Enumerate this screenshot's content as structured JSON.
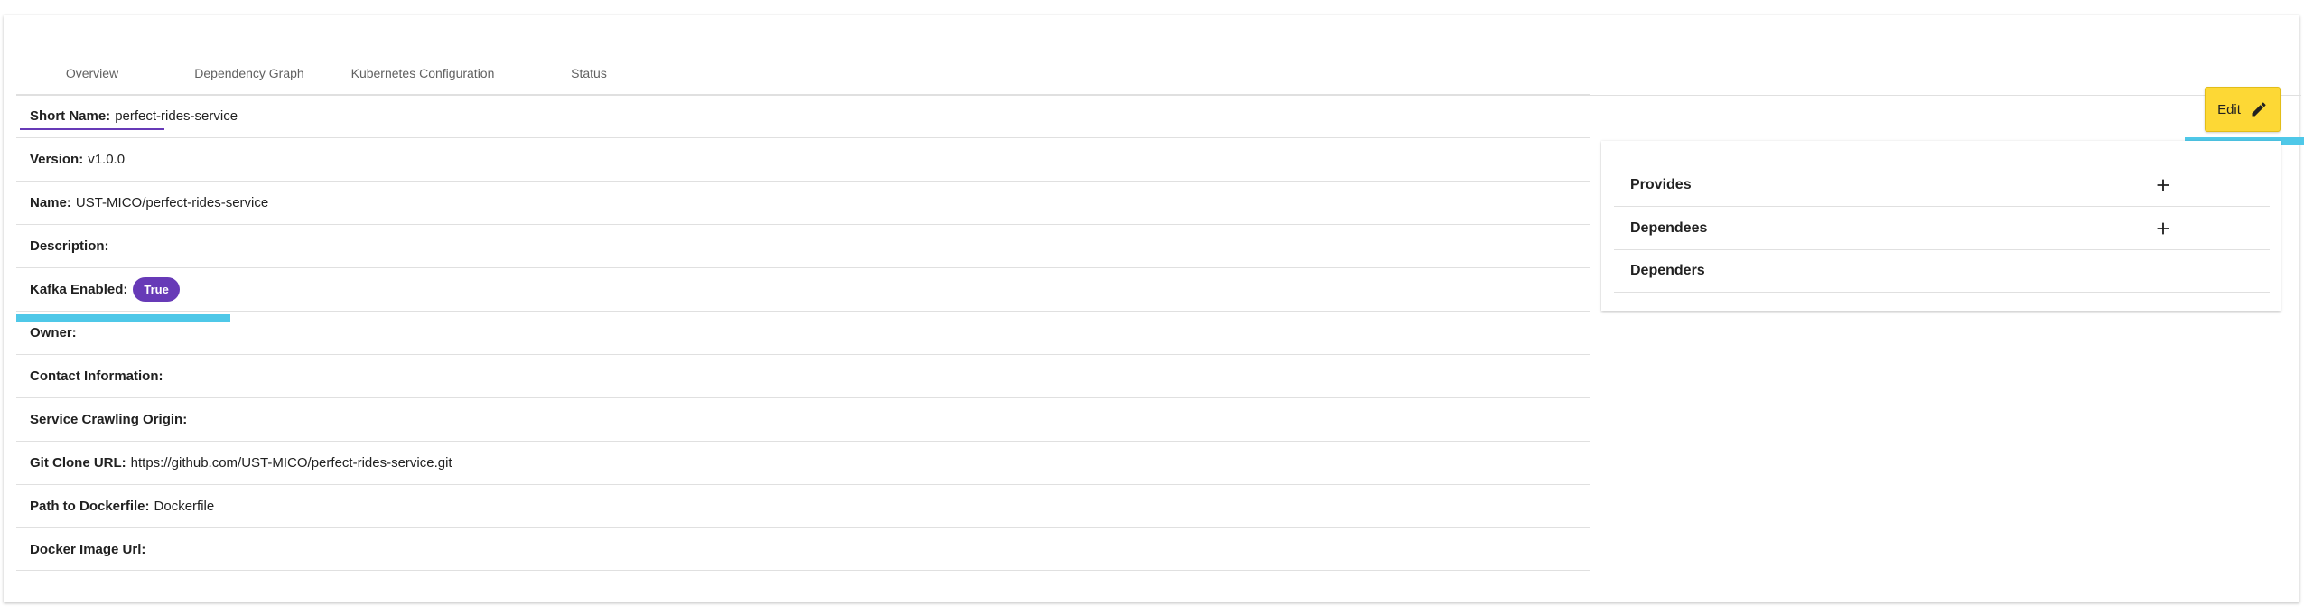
{
  "tabs": [
    {
      "label": "Overview"
    },
    {
      "label": "Dependency Graph"
    },
    {
      "label": "Kubernetes Configuration"
    },
    {
      "label": "Status"
    }
  ],
  "properties": [
    {
      "label": "Short Name:",
      "value": "perfect-rides-service"
    },
    {
      "label": "Version:",
      "value": "v1.0.0"
    },
    {
      "label": "Name:",
      "value": "UST-MICO/perfect-rides-service"
    },
    {
      "label": "Description:",
      "value": ""
    },
    {
      "label": "Kafka Enabled:",
      "value": "",
      "badge": "True"
    },
    {
      "label": "Owner:",
      "value": ""
    },
    {
      "label": "Contact Information:",
      "value": ""
    },
    {
      "label": "Service Crawling Origin:",
      "value": ""
    },
    {
      "label": "Git Clone URL:",
      "value": "https://github.com/UST-MICO/perfect-rides-service.git"
    },
    {
      "label": "Path to Dockerfile:",
      "value": "Dockerfile"
    },
    {
      "label": "Docker Image Url:",
      "value": ""
    }
  ],
  "edit": {
    "label": "Edit",
    "icon": "pencil-icon"
  },
  "side_sections": [
    {
      "label": "Provides",
      "icon": "plus-icon"
    },
    {
      "label": "Dependees",
      "icon": "plus-icon"
    },
    {
      "label": "Dependers"
    }
  ],
  "colors": {
    "accent": "#673ab7",
    "edit_button": "#fdd835",
    "highlight": "#4fc8e8"
  }
}
